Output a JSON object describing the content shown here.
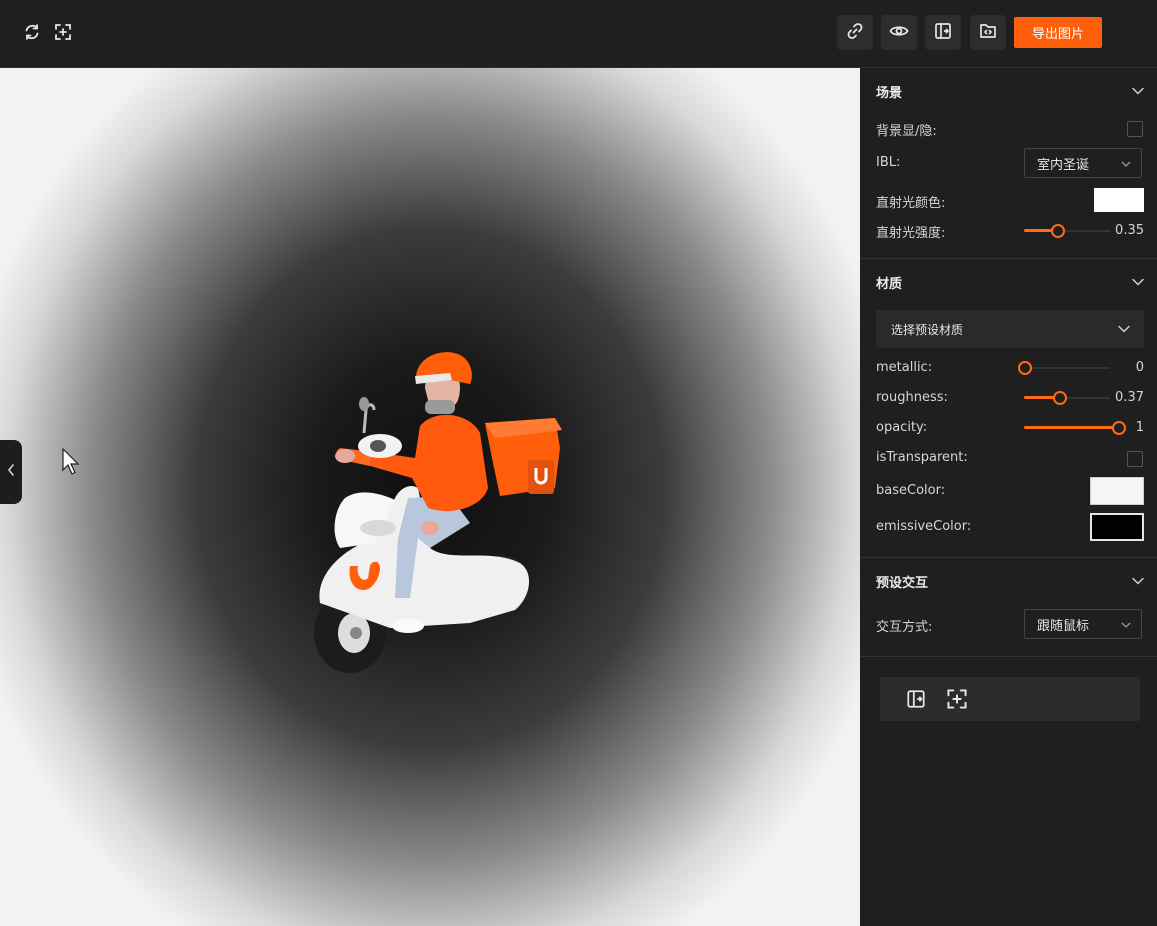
{
  "toolbar": {
    "left_icons": [
      "refresh-icon",
      "crosshair-icon"
    ],
    "right_icons": [
      "link-icon",
      "eye-icon",
      "panel-exit-icon",
      "folder-code-icon"
    ],
    "export_label": "导出图片",
    "accent": "#ff5f0a"
  },
  "scene": {
    "title": "场景",
    "bg_toggle_label": "背景显/隐:",
    "ibl_label": "IBL:",
    "ibl_value": "室内圣诞",
    "light_color_label": "直射光颜色:",
    "light_color": "#ffffff",
    "light_intensity_label": "直射光强度:",
    "light_intensity": "0.35"
  },
  "material": {
    "title": "材质",
    "preset_placeholder": "选择预设材质",
    "metallic_label": "metallic:",
    "metallic": "0",
    "roughness_label": "roughness:",
    "roughness": "0.37",
    "opacity_label": "opacity:",
    "opacity": "1",
    "transparent_label": "isTransparent:",
    "base_color_label": "baseColor:",
    "base_color": "#f5f5f5",
    "emissive_label": "emissiveColor:",
    "emissive_color": "#000000"
  },
  "interaction": {
    "title": "预设交互",
    "mode_label": "交互方式:",
    "mode_value": "跟随鼠标"
  },
  "bottom_tools": [
    "panel-exit-icon",
    "crosshair-icon"
  ]
}
